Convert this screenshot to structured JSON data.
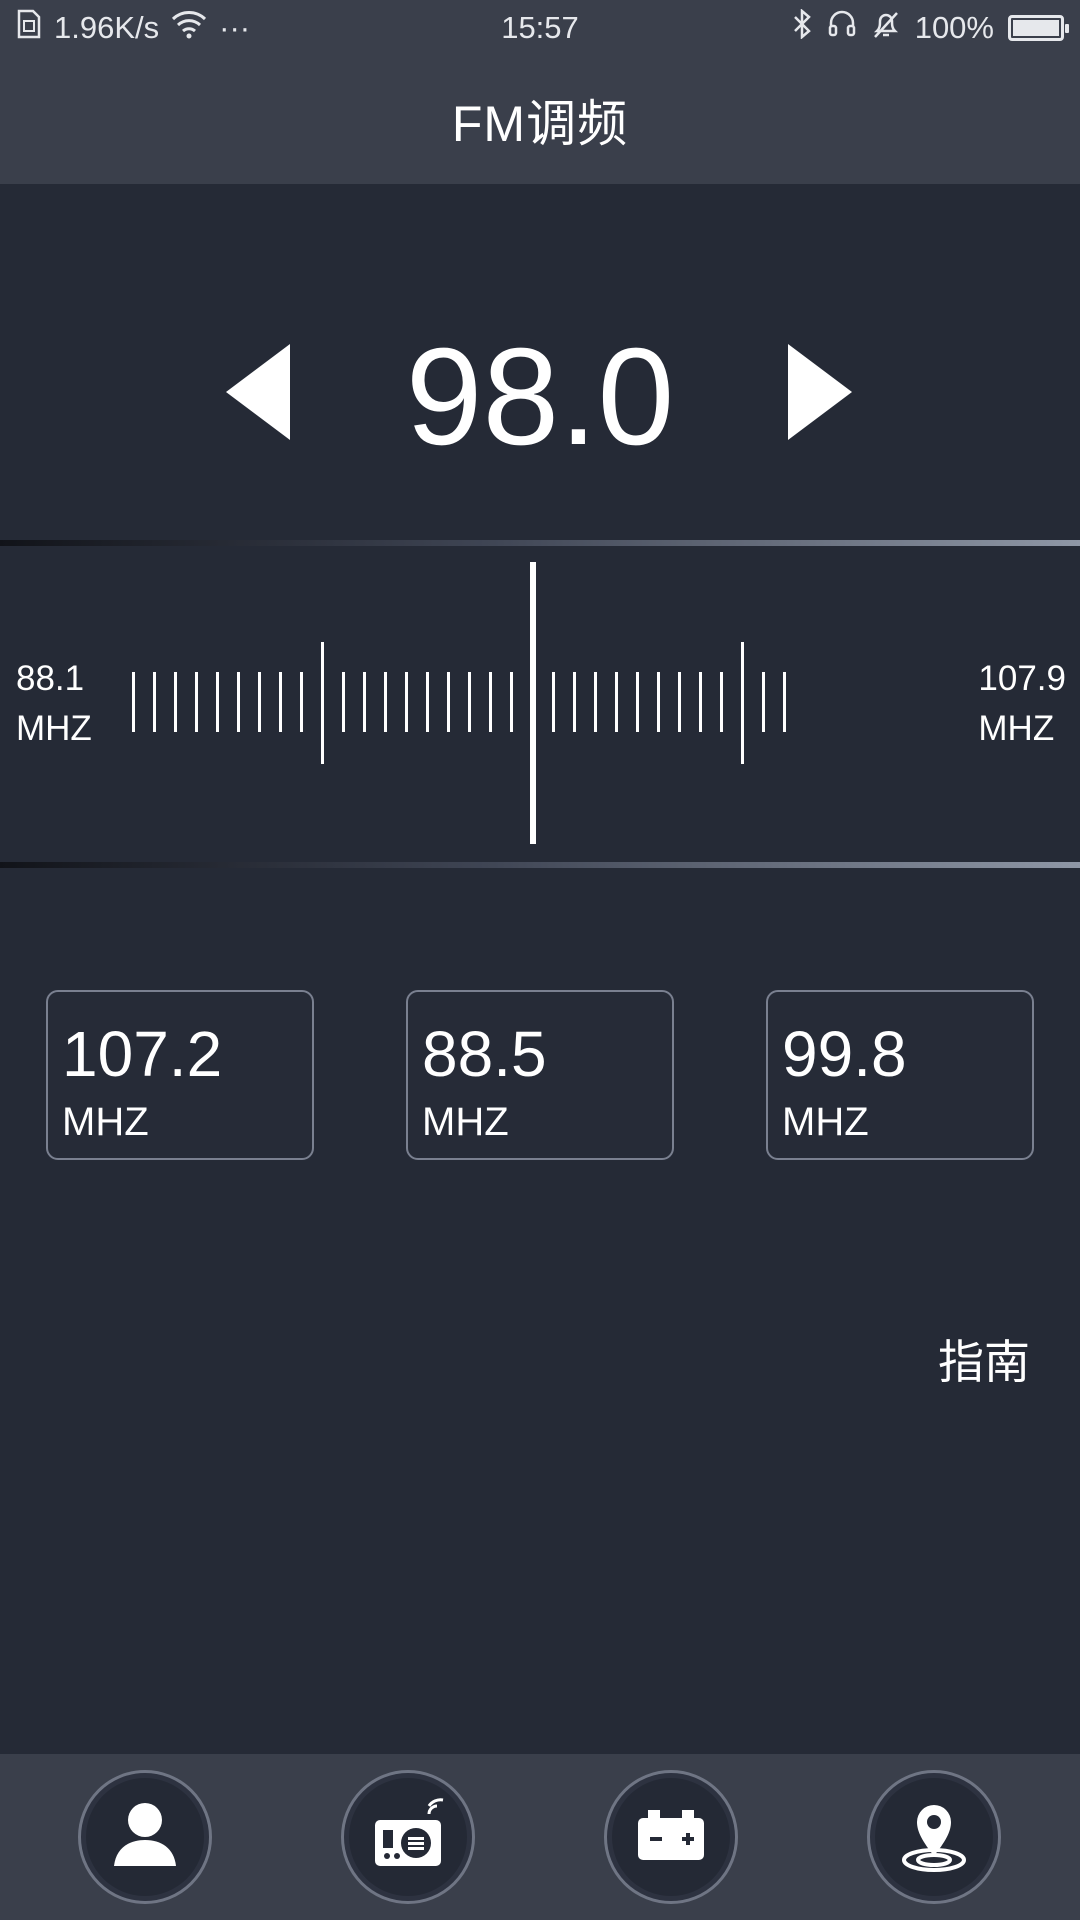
{
  "status_bar": {
    "network_speed": "1.96K/s",
    "more": "···",
    "time": "15:57",
    "battery": "100%",
    "icons": [
      "sim-icon",
      "wifi-icon",
      "bluetooth-icon",
      "headset-icon",
      "bell-muted-icon",
      "battery-icon"
    ]
  },
  "header": {
    "title": "FM调频"
  },
  "tuner": {
    "frequency": "98.0",
    "min_freq": "88.1",
    "min_unit": "MHZ",
    "max_freq": "107.9",
    "max_unit": "MHZ"
  },
  "presets": [
    {
      "freq": "107.2",
      "unit": "MHZ"
    },
    {
      "freq": "88.5",
      "unit": "MHZ"
    },
    {
      "freq": "99.8",
      "unit": "MHZ"
    }
  ],
  "guide": {
    "label": "指南"
  },
  "bottom_nav": {
    "items": [
      {
        "icon": "user-icon"
      },
      {
        "icon": "radio-icon"
      },
      {
        "icon": "battery-charge-icon"
      },
      {
        "icon": "location-pin-icon"
      }
    ]
  },
  "colors": {
    "background": "#252a36",
    "bar": "#3a3f4b",
    "text": "#ffffff"
  }
}
